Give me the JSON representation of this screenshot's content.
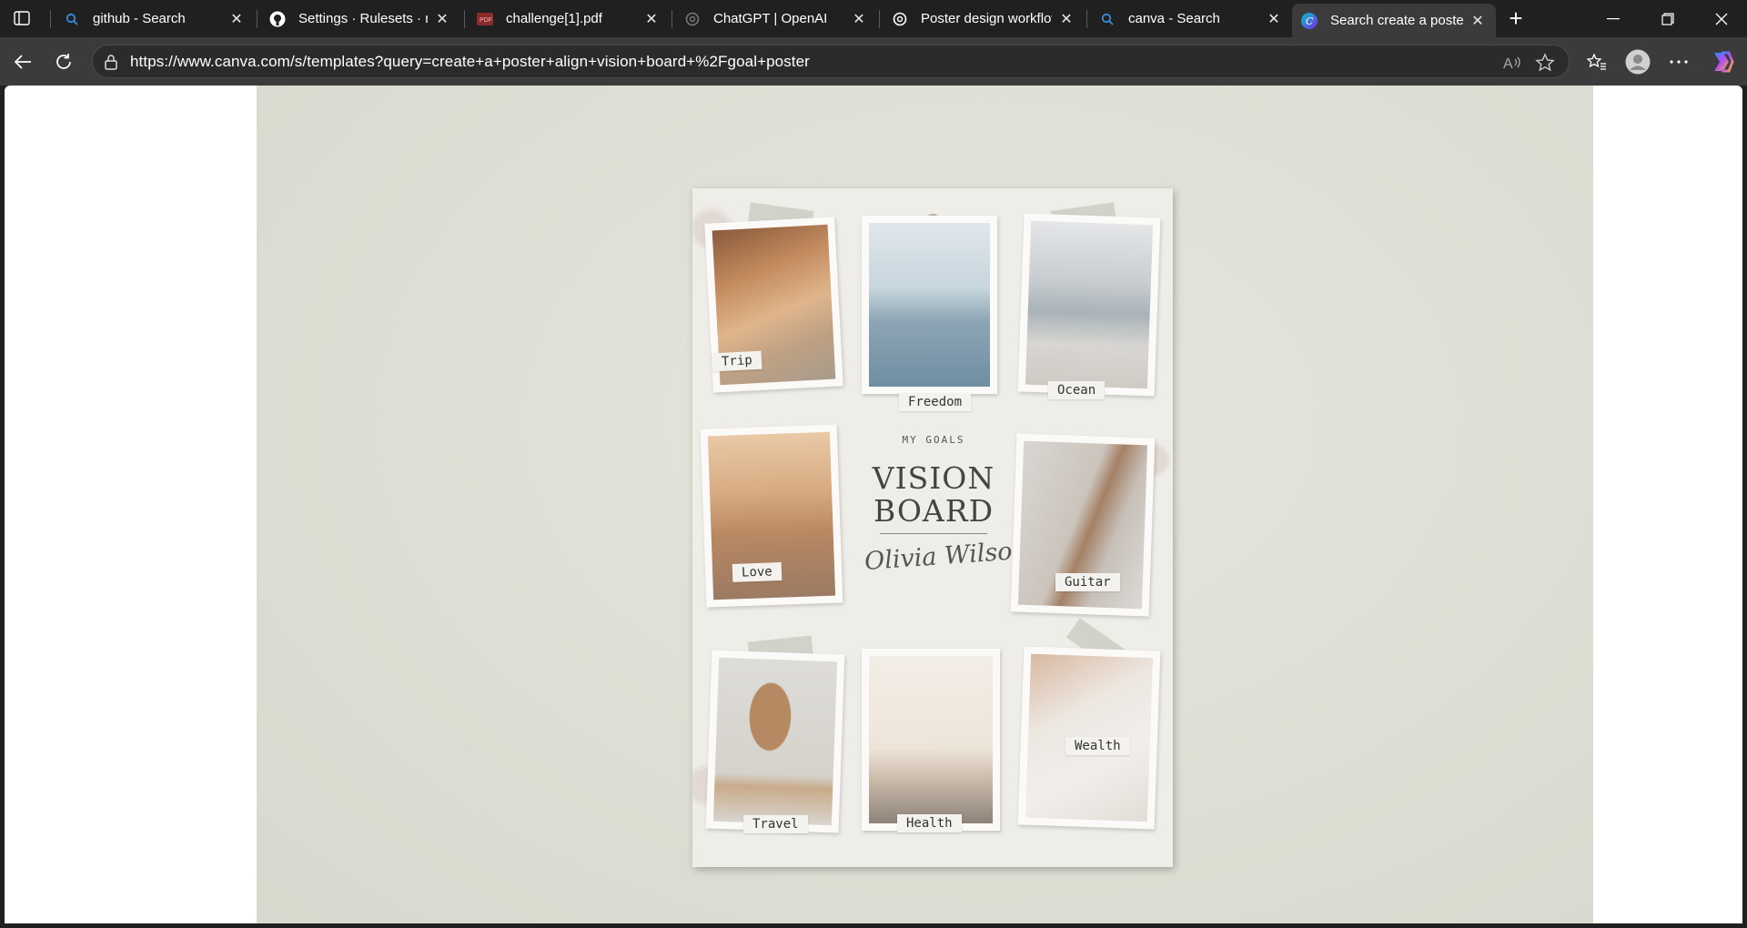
{
  "browser": {
    "tabs": [
      {
        "title": "github - Search",
        "icon": "search-icon",
        "active": false
      },
      {
        "title": "Settings · Rulesets · my",
        "icon": "github-icon",
        "active": false
      },
      {
        "title": "challenge[1].pdf",
        "icon": "pdf-icon",
        "active": false
      },
      {
        "title": "ChatGPT | OpenAI",
        "icon": "openai-icon",
        "active": false
      },
      {
        "title": "Poster design workflow",
        "icon": "openai-icon",
        "active": false
      },
      {
        "title": "canva - Search",
        "icon": "search-icon",
        "active": false
      },
      {
        "title": "Search create a poster",
        "icon": "canva-icon",
        "active": true
      }
    ],
    "url": "https://www.canva.com/s/templates?query=create+a+poster+align+vision+board+%2Fgoal+poster"
  },
  "poster": {
    "kicker": "MY GOALS",
    "title_line1": "VISION",
    "title_line2": "BOARD",
    "signature": "Olivia Wilson",
    "photos": [
      {
        "label": "Trip"
      },
      {
        "label": "Freedom"
      },
      {
        "label": "Ocean"
      },
      {
        "label": "Love"
      },
      {
        "label": "Guitar"
      },
      {
        "label": "Travel"
      },
      {
        "label": "Health"
      },
      {
        "label": "Wealth"
      }
    ]
  },
  "colors": {
    "tabstrip_bg": "#202020",
    "toolbar_bg": "#3b3b3b",
    "stage_bg": "#dedfd4",
    "poster_bg": "#efede8"
  }
}
